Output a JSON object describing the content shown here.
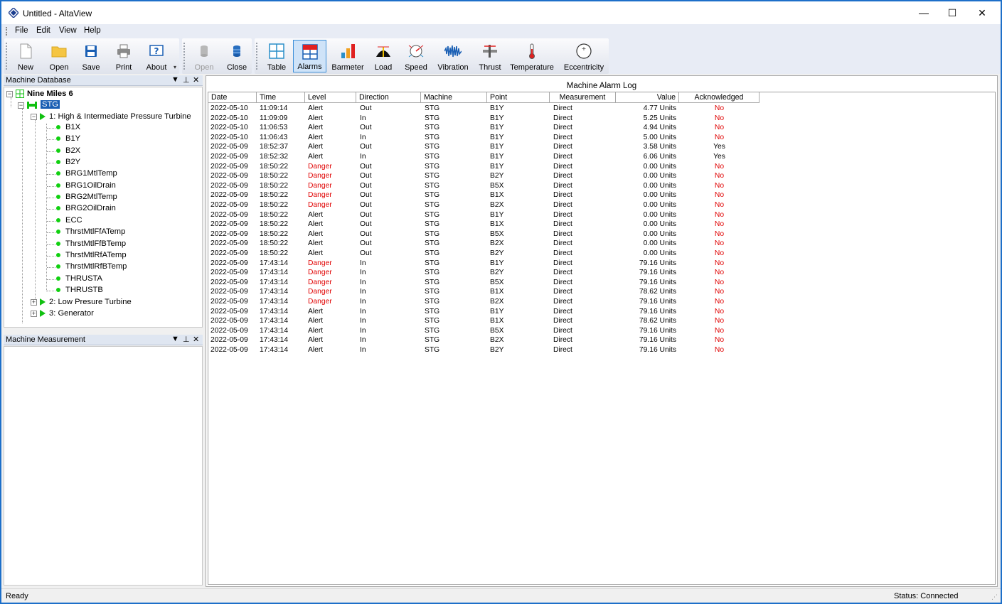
{
  "window": {
    "title": "Untitled - AltaView",
    "minimize": "—",
    "maximize": "☐",
    "close": "✕"
  },
  "menu": [
    "File",
    "Edit",
    "View",
    "Help"
  ],
  "toolbar": {
    "file_buttons": [
      {
        "label": "New",
        "icon": "new-document-icon"
      },
      {
        "label": "Open",
        "icon": "open-folder-icon"
      },
      {
        "label": "Save",
        "icon": "save-disk-icon"
      },
      {
        "label": "Print",
        "icon": "printer-icon"
      },
      {
        "label": "About",
        "icon": "help-icon"
      }
    ],
    "db_buttons": [
      {
        "label": "Open",
        "icon": "database-open-icon",
        "disabled": true
      },
      {
        "label": "Close",
        "icon": "database-close-icon",
        "disabled": false
      }
    ],
    "view_buttons": [
      {
        "label": "Table",
        "icon": "table-grid-icon"
      },
      {
        "label": "Alarms",
        "icon": "alarms-icon",
        "active": true
      },
      {
        "label": "Barmeter",
        "icon": "bar-chart-icon"
      },
      {
        "label": "Load",
        "icon": "load-icon"
      },
      {
        "label": "Speed",
        "icon": "speed-gauge-icon"
      },
      {
        "label": "Vibration",
        "icon": "vibration-wave-icon"
      },
      {
        "label": "Thrust",
        "icon": "thrust-icon"
      },
      {
        "label": "Temperature",
        "icon": "thermometer-icon"
      },
      {
        "label": "Eccentricity",
        "icon": "eccentricity-icon"
      }
    ]
  },
  "machine_database": {
    "title": "Machine Database",
    "pin": "⊥",
    "root": "Nine Miles 6",
    "machine": "STG",
    "trains": [
      {
        "label": "1: High & Intermediate Pressure Turbine",
        "expanded": true,
        "points": [
          "B1X",
          "B1Y",
          "B2X",
          "B2Y",
          "BRG1MtlTemp",
          "BRG1OilDrain",
          "BRG2MtlTemp",
          "BRG2OilDrain",
          "ECC",
          "ThrstMtlFfATemp",
          "ThrstMtlFfBTemp",
          "ThrstMtlRfATemp",
          "ThrstMtlRfBTemp",
          "THRUSTA",
          "THRUSTB"
        ]
      },
      {
        "label": "2: Low Presure Turbine",
        "expanded": false,
        "points": []
      },
      {
        "label": "3: Generator",
        "expanded": false,
        "points": []
      }
    ]
  },
  "machine_measurement": {
    "title": "Machine Measurement"
  },
  "alarm_log": {
    "title": "Machine Alarm Log",
    "columns": [
      "Date",
      "Time",
      "Level",
      "Direction",
      "Machine",
      "Point",
      "Measurement",
      "Value",
      "Acknowledged"
    ],
    "rows": [
      [
        "2022-05-10",
        "11:09:14",
        "Alert",
        "Out",
        "STG",
        "B1Y",
        "Direct",
        "4.77 Units",
        "No"
      ],
      [
        "2022-05-10",
        "11:09:09",
        "Alert",
        "In",
        "STG",
        "B1Y",
        "Direct",
        "5.25 Units",
        "No"
      ],
      [
        "2022-05-10",
        "11:06:53",
        "Alert",
        "Out",
        "STG",
        "B1Y",
        "Direct",
        "4.94 Units",
        "No"
      ],
      [
        "2022-05-10",
        "11:06:43",
        "Alert",
        "In",
        "STG",
        "B1Y",
        "Direct",
        "5.00 Units",
        "No"
      ],
      [
        "2022-05-09",
        "18:52:37",
        "Alert",
        "Out",
        "STG",
        "B1Y",
        "Direct",
        "3.58 Units",
        "Yes"
      ],
      [
        "2022-05-09",
        "18:52:32",
        "Alert",
        "In",
        "STG",
        "B1Y",
        "Direct",
        "6.06 Units",
        "Yes"
      ],
      [
        "2022-05-09",
        "18:50:22",
        "Danger",
        "Out",
        "STG",
        "B1Y",
        "Direct",
        "0.00 Units",
        "No"
      ],
      [
        "2022-05-09",
        "18:50:22",
        "Danger",
        "Out",
        "STG",
        "B2Y",
        "Direct",
        "0.00 Units",
        "No"
      ],
      [
        "2022-05-09",
        "18:50:22",
        "Danger",
        "Out",
        "STG",
        "B5X",
        "Direct",
        "0.00 Units",
        "No"
      ],
      [
        "2022-05-09",
        "18:50:22",
        "Danger",
        "Out",
        "STG",
        "B1X",
        "Direct",
        "0.00 Units",
        "No"
      ],
      [
        "2022-05-09",
        "18:50:22",
        "Danger",
        "Out",
        "STG",
        "B2X",
        "Direct",
        "0.00 Units",
        "No"
      ],
      [
        "2022-05-09",
        "18:50:22",
        "Alert",
        "Out",
        "STG",
        "B1Y",
        "Direct",
        "0.00 Units",
        "No"
      ],
      [
        "2022-05-09",
        "18:50:22",
        "Alert",
        "Out",
        "STG",
        "B1X",
        "Direct",
        "0.00 Units",
        "No"
      ],
      [
        "2022-05-09",
        "18:50:22",
        "Alert",
        "Out",
        "STG",
        "B5X",
        "Direct",
        "0.00 Units",
        "No"
      ],
      [
        "2022-05-09",
        "18:50:22",
        "Alert",
        "Out",
        "STG",
        "B2X",
        "Direct",
        "0.00 Units",
        "No"
      ],
      [
        "2022-05-09",
        "18:50:22",
        "Alert",
        "Out",
        "STG",
        "B2Y",
        "Direct",
        "0.00 Units",
        "No"
      ],
      [
        "2022-05-09",
        "17:43:14",
        "Danger",
        "In",
        "STG",
        "B1Y",
        "Direct",
        "79.16 Units",
        "No"
      ],
      [
        "2022-05-09",
        "17:43:14",
        "Danger",
        "In",
        "STG",
        "B2Y",
        "Direct",
        "79.16 Units",
        "No"
      ],
      [
        "2022-05-09",
        "17:43:14",
        "Danger",
        "In",
        "STG",
        "B5X",
        "Direct",
        "79.16 Units",
        "No"
      ],
      [
        "2022-05-09",
        "17:43:14",
        "Danger",
        "In",
        "STG",
        "B1X",
        "Direct",
        "78.62 Units",
        "No"
      ],
      [
        "2022-05-09",
        "17:43:14",
        "Danger",
        "In",
        "STG",
        "B2X",
        "Direct",
        "79.16 Units",
        "No"
      ],
      [
        "2022-05-09",
        "17:43:14",
        "Alert",
        "In",
        "STG",
        "B1Y",
        "Direct",
        "79.16 Units",
        "No"
      ],
      [
        "2022-05-09",
        "17:43:14",
        "Alert",
        "In",
        "STG",
        "B1X",
        "Direct",
        "78.62 Units",
        "No"
      ],
      [
        "2022-05-09",
        "17:43:14",
        "Alert",
        "In",
        "STG",
        "B5X",
        "Direct",
        "79.16 Units",
        "No"
      ],
      [
        "2022-05-09",
        "17:43:14",
        "Alert",
        "In",
        "STG",
        "B2X",
        "Direct",
        "79.16 Units",
        "No"
      ],
      [
        "2022-05-09",
        "17:43:14",
        "Alert",
        "In",
        "STG",
        "B2Y",
        "Direct",
        "79.16 Units",
        "No"
      ]
    ]
  },
  "status": {
    "left": "Ready",
    "right": "Status: Connected"
  },
  "colors": {
    "danger": "#e00000",
    "no": "#e00000",
    "accent": "#3c8fd9",
    "ok_dot": "#10d010",
    "window_border": "#1d6fc9"
  }
}
